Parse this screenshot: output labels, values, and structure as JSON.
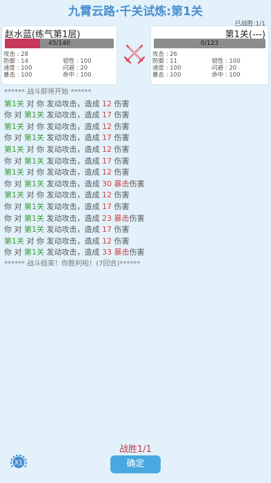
{
  "header": {
    "title": "九霄云路·千关试炼:第1关",
    "wins": "已战胜:1/1"
  },
  "player": {
    "name": "赵水蓝(练气第1层)",
    "hp_text": "45/140",
    "hp_fraction": 0.321,
    "stats": [
      [
        "攻击 : 28",
        ""
      ],
      [
        "防御 : 14",
        "韧性 : 100"
      ],
      [
        "速度 : 100",
        "闪避 : 20"
      ],
      [
        "暴击 : 100",
        "命中 : 100"
      ]
    ]
  },
  "enemy": {
    "name": "第1关(---)",
    "hp_text": "0/123",
    "hp_fraction": 0,
    "stats": [
      [
        "攻击 : 26",
        ""
      ],
      [
        "防御 : 11",
        "韧性 : 100"
      ],
      [
        "速度 : 100",
        "闪避 : 20"
      ],
      [
        "暴击 : 100",
        "命中 : 100"
      ]
    ]
  },
  "log": {
    "start": "****** 战斗即将开始 ******",
    "entries": [
      {
        "attacker": "第1关",
        "a_green": true,
        "target": "你",
        "t_green": false,
        "dmg": "12",
        "crit": false
      },
      {
        "attacker": "你",
        "a_green": false,
        "target": "第1关",
        "t_green": true,
        "dmg": "17",
        "crit": false
      },
      {
        "attacker": "第1关",
        "a_green": true,
        "target": "你",
        "t_green": false,
        "dmg": "12",
        "crit": false
      },
      {
        "attacker": "你",
        "a_green": false,
        "target": "第1关",
        "t_green": true,
        "dmg": "17",
        "crit": false
      },
      {
        "attacker": "第1关",
        "a_green": true,
        "target": "你",
        "t_green": false,
        "dmg": "12",
        "crit": false
      },
      {
        "attacker": "你",
        "a_green": false,
        "target": "第1关",
        "t_green": true,
        "dmg": "17",
        "crit": false
      },
      {
        "attacker": "第1关",
        "a_green": true,
        "target": "你",
        "t_green": false,
        "dmg": "12",
        "crit": false
      },
      {
        "attacker": "你",
        "a_green": false,
        "target": "第1关",
        "t_green": true,
        "dmg": "30",
        "crit": true
      },
      {
        "attacker": "第1关",
        "a_green": true,
        "target": "你",
        "t_green": false,
        "dmg": "12",
        "crit": false
      },
      {
        "attacker": "你",
        "a_green": false,
        "target": "第1关",
        "t_green": true,
        "dmg": "17",
        "crit": false
      },
      {
        "attacker": "你",
        "a_green": false,
        "target": "第1关",
        "t_green": true,
        "dmg": "23",
        "crit": true
      },
      {
        "attacker": "你",
        "a_green": false,
        "target": "第1关",
        "t_green": true,
        "dmg": "17",
        "crit": false
      },
      {
        "attacker": "第1关",
        "a_green": true,
        "target": "你",
        "t_green": false,
        "dmg": "12",
        "crit": false
      },
      {
        "attacker": "你",
        "a_green": false,
        "target": "第1关",
        "t_green": true,
        "dmg": "33",
        "crit": true
      }
    ],
    "end": "****** 战斗结束！你胜利啦！(7回合)******",
    "words": {
      "vs": " 对 ",
      "action": " 发动攻击，造成 ",
      "crit": "暴击",
      "damage": "伤害"
    }
  },
  "footer": {
    "victory": "战胜1/1",
    "confirm": "确定",
    "speed": "X1"
  },
  "colors": {
    "accent": "#48a9e0",
    "hp": "#c7375a",
    "green": "#3a9a3a",
    "red": "#d04040",
    "bg": "#e3f2fa"
  },
  "icons": {
    "vs": "crossed-swords-icon",
    "speed": "speed-x1-icon"
  }
}
